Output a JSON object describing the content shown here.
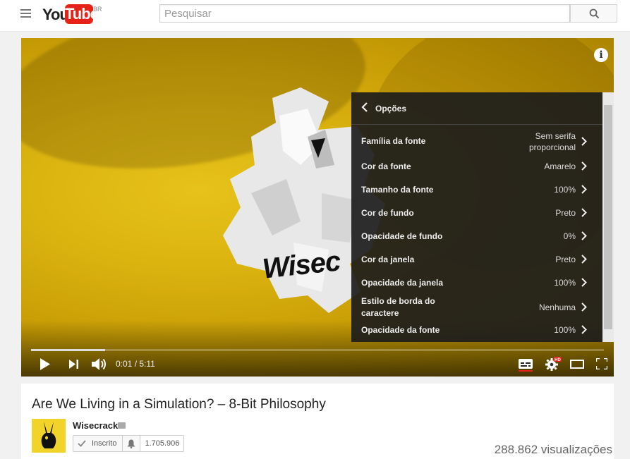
{
  "header": {
    "logo_you": "You",
    "logo_tube": "Tube",
    "country": "BR",
    "search_placeholder": "Pesquisar"
  },
  "player": {
    "brand_word": "Wisec",
    "info_icon": "info-icon",
    "settings": {
      "title": "Opções",
      "options": [
        {
          "label": "Família da fonte",
          "value": "Sem serifa proporcional"
        },
        {
          "label": "Cor da fonte",
          "value": "Amarelo"
        },
        {
          "label": "Tamanho da fonte",
          "value": "100%"
        },
        {
          "label": "Cor de fundo",
          "value": "Preto"
        },
        {
          "label": "Opacidade de fundo",
          "value": "0%"
        },
        {
          "label": "Cor da janela",
          "value": "Preto"
        },
        {
          "label": "Opacidade da janela",
          "value": "100%"
        },
        {
          "label": "Estilo de borda do caractere",
          "value": "Nenhuma"
        },
        {
          "label": "Opacidade da fonte",
          "value": "100%"
        }
      ]
    },
    "progress_fraction": 0.129,
    "time_current": "0:01",
    "time_separator": " / ",
    "time_total": "5:11",
    "hd_badge": "HD",
    "accent_color": "#e62117"
  },
  "video": {
    "title": "Are We Living in a Simulation? – 8-Bit Philosophy",
    "channel": "Wisecrack",
    "subscribe_label": "Inscrito",
    "subscriber_count": "1.705.906",
    "views": "288.862 visualizações"
  }
}
